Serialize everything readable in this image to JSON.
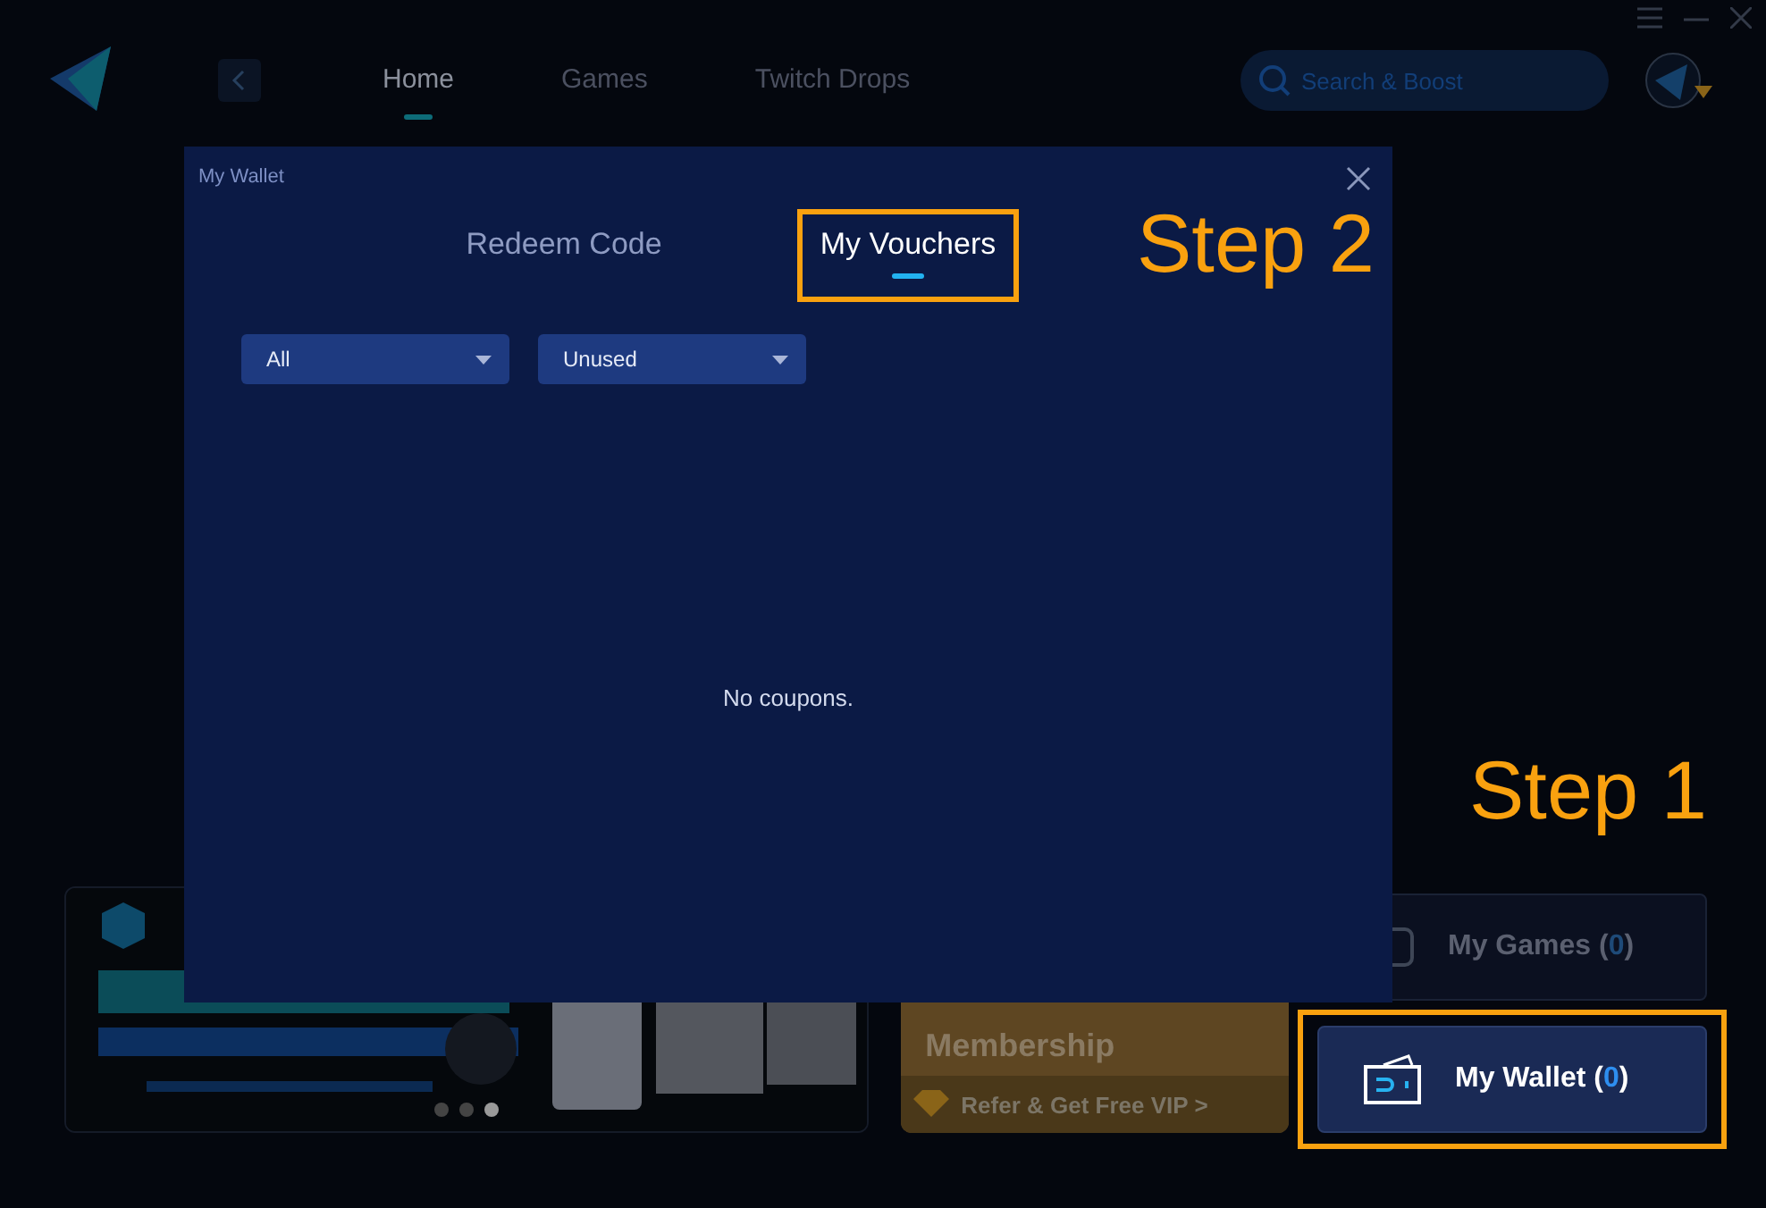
{
  "nav": {
    "tabs": [
      {
        "label": "Home",
        "selected": true
      },
      {
        "label": "Games",
        "selected": false
      },
      {
        "label": "Twitch Drops",
        "selected": false
      }
    ]
  },
  "search": {
    "placeholder": "Search & Boost"
  },
  "banner": {
    "kind": "picture",
    "dots": [
      {
        "selected": false
      },
      {
        "selected": false
      },
      {
        "selected": true
      }
    ]
  },
  "membership": {
    "title": "Membership",
    "link": "Refer & Get Free VIP >"
  },
  "shortcuts": [
    {
      "label": "My Games",
      "count": "(0)",
      "highlighted": false
    },
    {
      "label": "My Wallet",
      "count": "(0)",
      "highlighted": true
    }
  ],
  "wallet_dialog": {
    "title": "My Wallet",
    "tabs": [
      {
        "label": "Redeem Code",
        "selected": false,
        "framed": false
      },
      {
        "label": "My Vouchers",
        "selected": true,
        "framed": true
      }
    ],
    "filters": [
      {
        "value": "All"
      },
      {
        "value": "Unused"
      }
    ],
    "empty_message": "No coupons."
  },
  "steps": [
    {
      "label": "Step 2"
    },
    {
      "label": "Step 1"
    }
  ]
}
